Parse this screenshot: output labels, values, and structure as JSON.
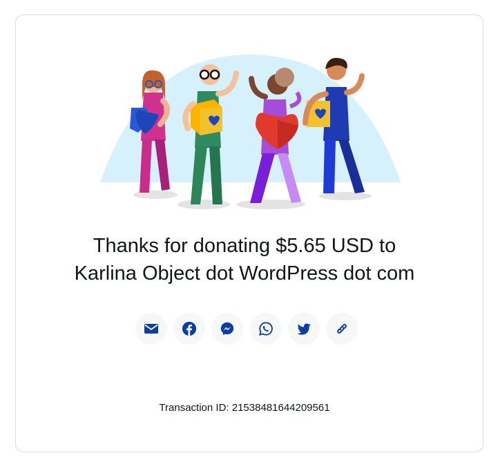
{
  "thank_you": {
    "line1": "Thanks for donating $5.65 USD to",
    "line2": "Karlina Object dot WordPress dot com"
  },
  "share_buttons": [
    {
      "icon": "mail-icon",
      "label": "Email"
    },
    {
      "icon": "facebook-icon",
      "label": "Facebook"
    },
    {
      "icon": "messenger-icon",
      "label": "Messenger"
    },
    {
      "icon": "whatsapp-icon",
      "label": "WhatsApp"
    },
    {
      "icon": "twitter-icon",
      "label": "Twitter"
    },
    {
      "icon": "link-icon",
      "label": "Copy link"
    }
  ],
  "transaction": {
    "text": "Transaction ID: 21538481644209561"
  },
  "colors": {
    "icon_blue": "#0a3ea0",
    "button_bg": "#f6f7f7",
    "text": "#101517",
    "backdrop": "#d6f0fc"
  }
}
